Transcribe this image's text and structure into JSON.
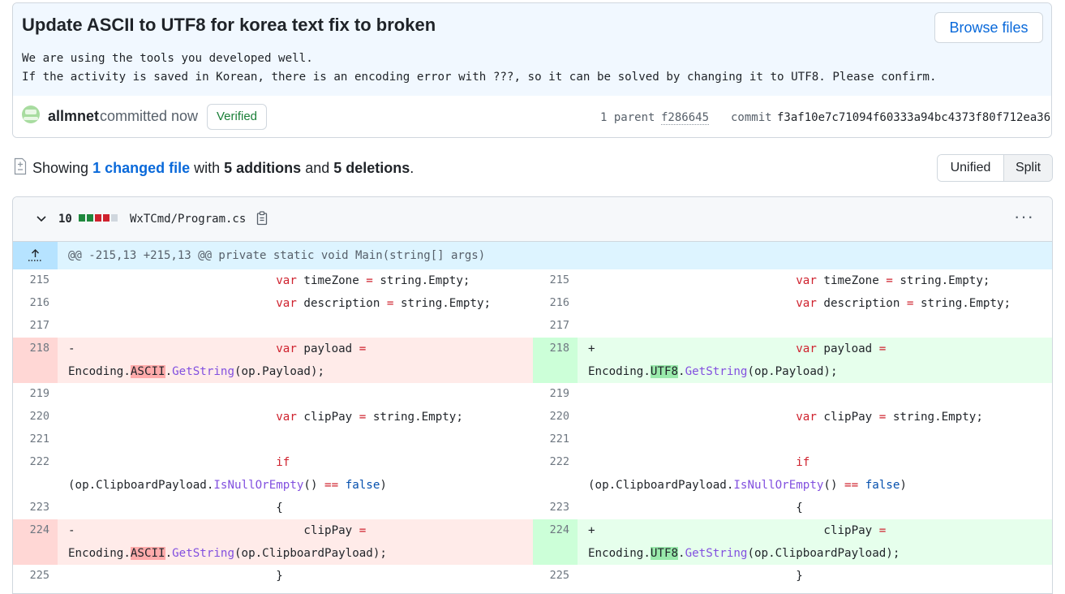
{
  "commit": {
    "title": "Update ASCII to UTF8 for korea text fix to broken",
    "browse_label": "Browse files",
    "description_lines": [
      "We are using the tools you developed well.",
      "If the activity is saved in Korean, there is an encoding error with ???, so it can be solved by changing it to UTF8. Please confirm."
    ],
    "author": "allmnet",
    "committed_text": "committed now",
    "verified_label": "Verified",
    "parent_label": "1 parent",
    "parent_sha": "f286645",
    "commit_label": "commit",
    "commit_sha": "f3af10e7c71094f60333a94bc4373f80f712ea36"
  },
  "summary": {
    "showing": "Showing",
    "changed_files": "1 changed file",
    "with": "with",
    "additions": "5 additions",
    "and": "and",
    "deletions": "5 deletions",
    "period": "."
  },
  "view_toggle": {
    "unified": "Unified",
    "split": "Split",
    "selected": "Split"
  },
  "file": {
    "change_count": "10",
    "stat_blocks": [
      "add",
      "add",
      "del",
      "del",
      "neutral"
    ],
    "path": "WxTCmd/Program.cs",
    "hunk_header": "@@ -215,13 +215,13 @@ private static void Main(string[] args)"
  },
  "diff": {
    "left": [
      {
        "type": "ctx",
        "num": "215",
        "lines": [
          [
            [
              "                              ",
              ""
            ],
            [
              "var",
              "kw"
            ],
            [
              " timeZone ",
              ""
            ],
            [
              "=",
              "kw"
            ],
            [
              " string.Empty;",
              ""
            ]
          ]
        ]
      },
      {
        "type": "ctx",
        "num": "216",
        "lines": [
          [
            [
              "                              ",
              ""
            ],
            [
              "var",
              "kw"
            ],
            [
              " description ",
              ""
            ],
            [
              "=",
              "kw"
            ],
            [
              " string.Empty;",
              ""
            ]
          ]
        ]
      },
      {
        "type": "ctx",
        "num": "217",
        "lines": [
          [
            [
              "",
              ""
            ]
          ]
        ]
      },
      {
        "type": "del",
        "num": "218",
        "lines": [
          [
            [
              "-                             ",
              ""
            ],
            [
              "var",
              "kw"
            ],
            [
              " payload ",
              ""
            ],
            [
              "=",
              "kw"
            ]
          ],
          [
            [
              "Encoding.",
              ""
            ],
            [
              "ASCII",
              "hl-del"
            ],
            [
              ".",
              ""
            ],
            [
              "GetString",
              "fn"
            ],
            [
              "(op.Payload);",
              ""
            ]
          ]
        ]
      },
      {
        "type": "ctx",
        "num": "219",
        "lines": [
          [
            [
              "",
              ""
            ]
          ]
        ]
      },
      {
        "type": "ctx",
        "num": "220",
        "lines": [
          [
            [
              "                              ",
              ""
            ],
            [
              "var",
              "kw"
            ],
            [
              " clipPay ",
              ""
            ],
            [
              "=",
              "kw"
            ],
            [
              " string.Empty;",
              ""
            ]
          ]
        ]
      },
      {
        "type": "ctx",
        "num": "221",
        "lines": [
          [
            [
              "",
              ""
            ]
          ]
        ]
      },
      {
        "type": "ctx",
        "num": "222",
        "lines": [
          [
            [
              "                              ",
              ""
            ],
            [
              "if",
              "kw"
            ]
          ],
          [
            [
              "(op.ClipboardPayload.",
              ""
            ],
            [
              "IsNullOrEmpty",
              "fn"
            ],
            [
              "() ",
              ""
            ],
            [
              "==",
              "kw"
            ],
            [
              " ",
              ""
            ],
            [
              "false",
              "ty"
            ],
            [
              ")",
              ""
            ]
          ]
        ]
      },
      {
        "type": "ctx",
        "num": "223",
        "lines": [
          [
            [
              "                              {",
              ""
            ]
          ]
        ]
      },
      {
        "type": "del",
        "num": "224",
        "lines": [
          [
            [
              "-                                 clipPay ",
              ""
            ],
            [
              "=",
              "kw"
            ]
          ],
          [
            [
              "Encoding.",
              ""
            ],
            [
              "ASCII",
              "hl-del"
            ],
            [
              ".",
              ""
            ],
            [
              "GetString",
              "fn"
            ],
            [
              "(op.ClipboardPayload);",
              ""
            ]
          ]
        ]
      },
      {
        "type": "ctx",
        "num": "225",
        "lines": [
          [
            [
              "                              }",
              ""
            ]
          ]
        ]
      }
    ],
    "right": [
      {
        "type": "ctx",
        "num": "215",
        "lines": [
          [
            [
              "                              ",
              ""
            ],
            [
              "var",
              "kw"
            ],
            [
              " timeZone ",
              ""
            ],
            [
              "=",
              "kw"
            ],
            [
              " string.Empty;",
              ""
            ]
          ]
        ]
      },
      {
        "type": "ctx",
        "num": "216",
        "lines": [
          [
            [
              "                              ",
              ""
            ],
            [
              "var",
              "kw"
            ],
            [
              " description ",
              ""
            ],
            [
              "=",
              "kw"
            ],
            [
              " string.Empty;",
              ""
            ]
          ]
        ]
      },
      {
        "type": "ctx",
        "num": "217",
        "lines": [
          [
            [
              "",
              ""
            ]
          ]
        ]
      },
      {
        "type": "add",
        "num": "218",
        "lines": [
          [
            [
              "+                             ",
              ""
            ],
            [
              "var",
              "kw"
            ],
            [
              " payload ",
              ""
            ],
            [
              "=",
              "kw"
            ]
          ],
          [
            [
              "Encoding.",
              ""
            ],
            [
              "UTF8",
              "hl-add"
            ],
            [
              ".",
              ""
            ],
            [
              "GetString",
              "fn"
            ],
            [
              "(op.Payload);",
              ""
            ]
          ]
        ]
      },
      {
        "type": "ctx",
        "num": "219",
        "lines": [
          [
            [
              "",
              ""
            ]
          ]
        ]
      },
      {
        "type": "ctx",
        "num": "220",
        "lines": [
          [
            [
              "                              ",
              ""
            ],
            [
              "var",
              "kw"
            ],
            [
              " clipPay ",
              ""
            ],
            [
              "=",
              "kw"
            ],
            [
              " string.Empty;",
              ""
            ]
          ]
        ]
      },
      {
        "type": "ctx",
        "num": "221",
        "lines": [
          [
            [
              "",
              ""
            ]
          ]
        ]
      },
      {
        "type": "ctx",
        "num": "222",
        "lines": [
          [
            [
              "                              ",
              ""
            ],
            [
              "if",
              "kw"
            ]
          ],
          [
            [
              "(op.ClipboardPayload.",
              ""
            ],
            [
              "IsNullOrEmpty",
              "fn"
            ],
            [
              "() ",
              ""
            ],
            [
              "==",
              "kw"
            ],
            [
              " ",
              ""
            ],
            [
              "false",
              "ty"
            ],
            [
              ")",
              ""
            ]
          ]
        ]
      },
      {
        "type": "ctx",
        "num": "223",
        "lines": [
          [
            [
              "                              {",
              ""
            ]
          ]
        ]
      },
      {
        "type": "add",
        "num": "224",
        "lines": [
          [
            [
              "+                                 clipPay ",
              ""
            ],
            [
              "=",
              "kw"
            ]
          ],
          [
            [
              "Encoding.",
              ""
            ],
            [
              "UTF8",
              "hl-add"
            ],
            [
              ".",
              ""
            ],
            [
              "GetString",
              "fn"
            ],
            [
              "(op.ClipboardPayload);",
              ""
            ]
          ]
        ]
      },
      {
        "type": "ctx",
        "num": "225",
        "lines": [
          [
            [
              "                              }",
              ""
            ]
          ]
        ]
      }
    ]
  },
  "colors": {
    "link": "#0969da",
    "verified": "#1a7f37",
    "addition_bg": "#e6ffec",
    "deletion_bg": "#ffebe9",
    "hunk_bg": "#ddf4ff",
    "keyword": "#cf222e",
    "function": "#8250df"
  },
  "icons": {
    "file_diff": "file-diff-icon",
    "chevron": "chevron-down-icon",
    "copy": "copy-icon",
    "menu": "kebab-icon",
    "expand": "expand-up-icon"
  }
}
